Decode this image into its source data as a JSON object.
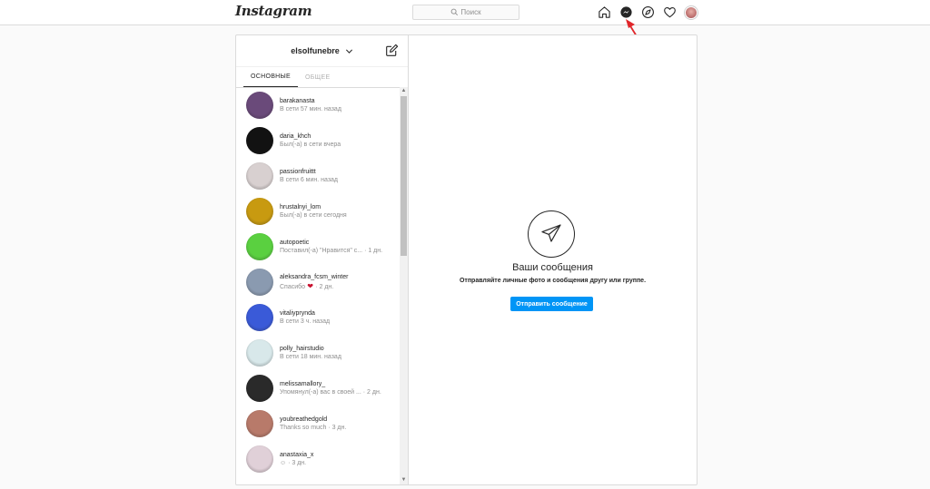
{
  "header": {
    "logo": "Instagram",
    "search_placeholder": "Поиск"
  },
  "direct": {
    "account": "elsolfunebre",
    "tabs": [
      {
        "label": "ОСНОВНЫЕ",
        "active": true
      },
      {
        "label": "ОБЩЕЕ",
        "active": false
      }
    ],
    "threads": [
      {
        "name": "barakanasta",
        "status": "В сети 57 мин. назад",
        "avatar_color": "#6a4a7a"
      },
      {
        "name": "daria_khch",
        "status": "Был(-а) в сети вчера",
        "avatar_color": "#121212"
      },
      {
        "name": "passionfruittt",
        "status": "В сети 6 мин. назад",
        "avatar_color": "#d8d0d0"
      },
      {
        "name": "hrustalnyi_lom",
        "status": "Был(-а) в сети сегодня",
        "avatar_color": "#c89a10"
      },
      {
        "name": "autopoetic",
        "status": "Поставил(-а) \"Нравится\" с... · 1 дн.",
        "avatar_color": "#5ad040"
      },
      {
        "name": "aleksandra_fcsm_winter",
        "status_before": "Спасибо",
        "status_after": "· 2 дн.",
        "avatar_color": "#8a9ab0"
      },
      {
        "name": "vitaliyprynda",
        "status": "В сети 3 ч. назад",
        "avatar_color": "#3a5ad8"
      },
      {
        "name": "polly_hairstudio",
        "status": "В сети 18 мин. назад",
        "avatar_color": "#d8e8ea"
      },
      {
        "name": "melissamallory_",
        "status": "Упомянул(-а) вас в своей ... · 2 дн.",
        "avatar_color": "#2a2a2a"
      },
      {
        "name": "youbreathedgold",
        "status": "Thanks so much · 3 дн.",
        "avatar_color": "#b87a6a"
      },
      {
        "name": "anastaxia_x",
        "status": "☺ · 3 дн.",
        "avatar_color": "#e0d0d8"
      }
    ],
    "empty": {
      "title": "Ваши сообщения",
      "description": "Отправляйте личные фото и сообщения другу или группе.",
      "button": "Отправить сообщение"
    }
  },
  "colors": {
    "accent": "#0095f6",
    "annotation_arrow": "#e0262a"
  }
}
